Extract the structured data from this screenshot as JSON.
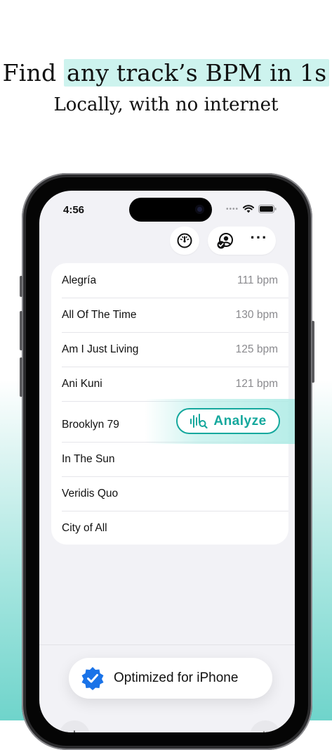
{
  "marketing": {
    "headline_plain": "Find",
    "headline_highlight": "any track’s BPM in 1s",
    "subheadline": "Locally, with no internet"
  },
  "status_bar": {
    "time": "4:56"
  },
  "tracks": [
    {
      "title": "Alegría",
      "bpm": "111 bpm"
    },
    {
      "title": "All Of The Time",
      "bpm": "130 bpm"
    },
    {
      "title": "Am I Just Living",
      "bpm": "125 bpm"
    },
    {
      "title": "Ani Kuni",
      "bpm": "121 bpm"
    },
    {
      "title": "Brooklyn 79",
      "bpm": ""
    },
    {
      "title": "In The Sun",
      "bpm": ""
    },
    {
      "title": "Veridis Quo",
      "bpm": ""
    },
    {
      "title": "City of All",
      "bpm": ""
    }
  ],
  "analyze_button": {
    "label": "Analyze",
    "icon": "waveform-search-icon"
  },
  "badge": {
    "label": "Optimized for iPhone",
    "icon": "verified-check-icon"
  },
  "toolbar": {
    "icons": [
      "tempo-gauge-icon",
      "account-check-icon",
      "more-icon"
    ]
  },
  "colors": {
    "accent": "#15a89d",
    "highlight": "#cdf3ee",
    "verified_blue": "#1a73e8"
  }
}
